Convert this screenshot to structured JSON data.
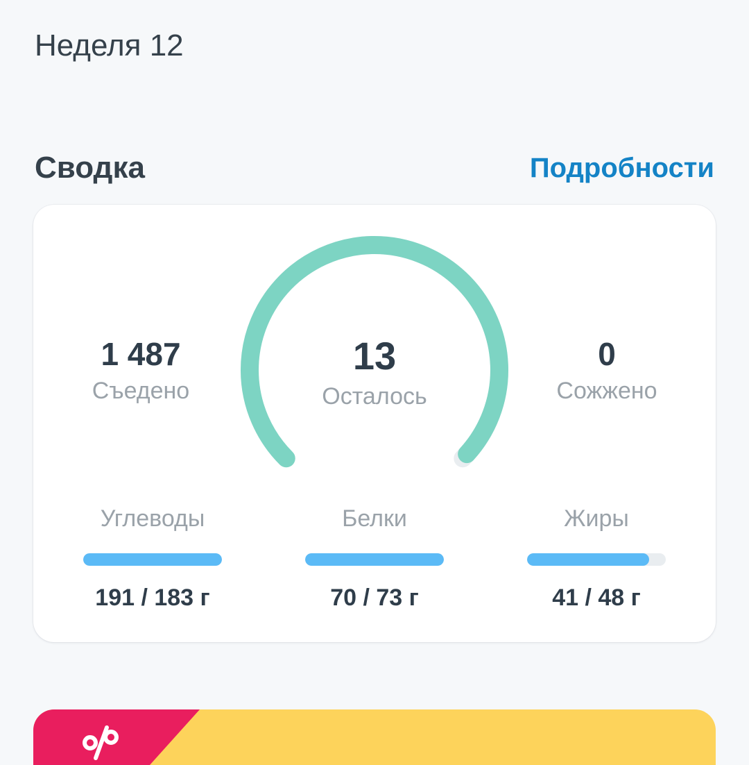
{
  "header": {
    "week_label": "Неделя 12"
  },
  "summary": {
    "title": "Сводка",
    "details_link": "Подробности"
  },
  "calories": {
    "eaten_value": "1 487",
    "eaten_label": "Съедено",
    "remaining_value": "13",
    "remaining_label": "Осталось",
    "burned_value": "0",
    "burned_label": "Сожжено",
    "gauge_progress": 0.99,
    "gauge_color": "#7dd4c3"
  },
  "macros": [
    {
      "label": "Углеводы",
      "value": "191 / 183 г",
      "progress": 1.0
    },
    {
      "label": "Белки",
      "value": "70 / 73 г",
      "progress": 1.0
    },
    {
      "label": "Жиры",
      "value": "41 / 48 г",
      "progress": 0.88
    }
  ],
  "colors": {
    "accent_link": "#1483c6",
    "macro_bar": "#5bbaf6",
    "promo_yellow": "#fdd35b",
    "promo_red": "#e91e5e"
  },
  "promo": {
    "icon": "percent-icon"
  }
}
